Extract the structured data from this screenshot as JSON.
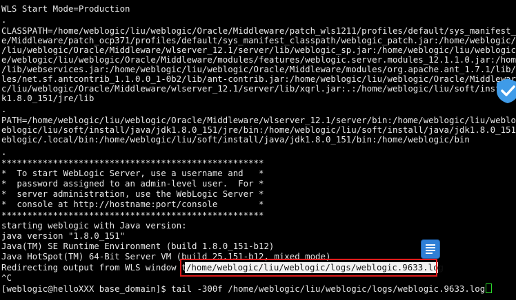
{
  "terminal": {
    "lines": [
      "WLS Start Mode=Production",
      ".",
      "CLASSPATH=/home/weblogic/liu/weblogic/Oracle/Middleware/patch_wls1211/profiles/default/sys_manifest_classpath/weblogic_patch.jar:/home/weblogic/liu/weblogic/Oracl",
      "e/Middleware/patch_ocp371/profiles/default/sys_manifest_classpath/weblogic_patch.jar:/home/weblogic/liu/soft/install/java/jdk1.8.0_151/lib/tools.jar:/home/weblogic",
      "/liu/weblogic/Oracle/Middleware/wlserver_12.1/server/lib/weblogic_sp.jar:/home/weblogic/liu/weblogic/Oracle/Middleware/wlserver_12.1/server/lib/weblogic.jar:/hom",
      "e/weblogic/liu/weblogic/Oracle/Middleware/modules/features/weblogic.server.modules_12.1.1.0.jar:/home/weblogic/liu/weblogic/Oracle/Middleware/wlserver_12.1/server",
      "/lib/webservices.jar:/home/weblogic/liu/weblogic/Oracle/Middleware/modules/org.apache.ant_1.7.1/lib/ant-all.jar:/home/weblogic/liu/weblogic/Oracle/Middleware/modu",
      "les/net.sf.antcontrib_1.1.0.0_1-0b2/lib/ant-contrib.jar:/home/weblogic/liu/weblogic/Oracle/Middleware/wlserver_12.1/common/derby/lib/derbyclient.jar:/home/weblogi",
      "c/liu/weblogic/Oracle/Middleware/wlserver_12.1/server/lib/xqrl.jar:.:/home/weblogic/liu/soft/install/java/jdk1.8.0_151/lib/dt.jar:/home/weblogic/liu/soft/install/java/jd",
      "k1.8.0_151/jre/lib",
      ".",
      "PATH=/home/weblogic/liu/weblogic/Oracle/Middleware/wlserver_12.1/server/bin:/home/weblogic/liu/weblogic/Oracle/Middleware/modules/org.apache.ant_1.7.1/bin:/home/w",
      "eblogic/liu/soft/install/java/jdk1.8.0_151/jre/bin:/home/weblogic/liu/soft/install/java/jdk1.8.0_151/bin:/usr/local/bin:/usr/bin:/usr/local/sbin:/usr/sbin:/home/w",
      "eblogic/.local/bin:/home/weblogic/liu/soft/install/java/jdk1.8.0_151/bin:/home/weblogic/bin",
      ".",
      "***************************************************",
      "*  To start WebLogic Server, use a username and   *",
      "*  password assigned to an admin-level user.  For *",
      "*  server administration, use the WebLogic Server *",
      "*  console at http://hostname:port/console        *",
      "***************************************************",
      "starting weblogic with Java version:",
      "java version \"1.8.0_151\"",
      "Java(TM) SE Runtime Environment (build 1.8.0_151-b12)",
      "Java HotSpot(TM) 64-Bit Server VM (build 25.151-b12, mixed mode)",
      "Redirecting output from WLS window to",
      "^C",
      "[weblogic@helloXXX base_domain]$ tail -300f /home/weblogic/liu/weblogic/logs/weblogic.9633.log"
    ],
    "highlighted_path": "/home/weblogic/liu/weblogic/logs/weblogic.9633.log",
    "cursor_color": "#2bd92b",
    "text_color": "#e8e8e8",
    "background_color": "#000000",
    "annotation_box_color": "#e01b1b"
  },
  "overlay_icons": [
    "shield-check-icon",
    "document-icon"
  ]
}
